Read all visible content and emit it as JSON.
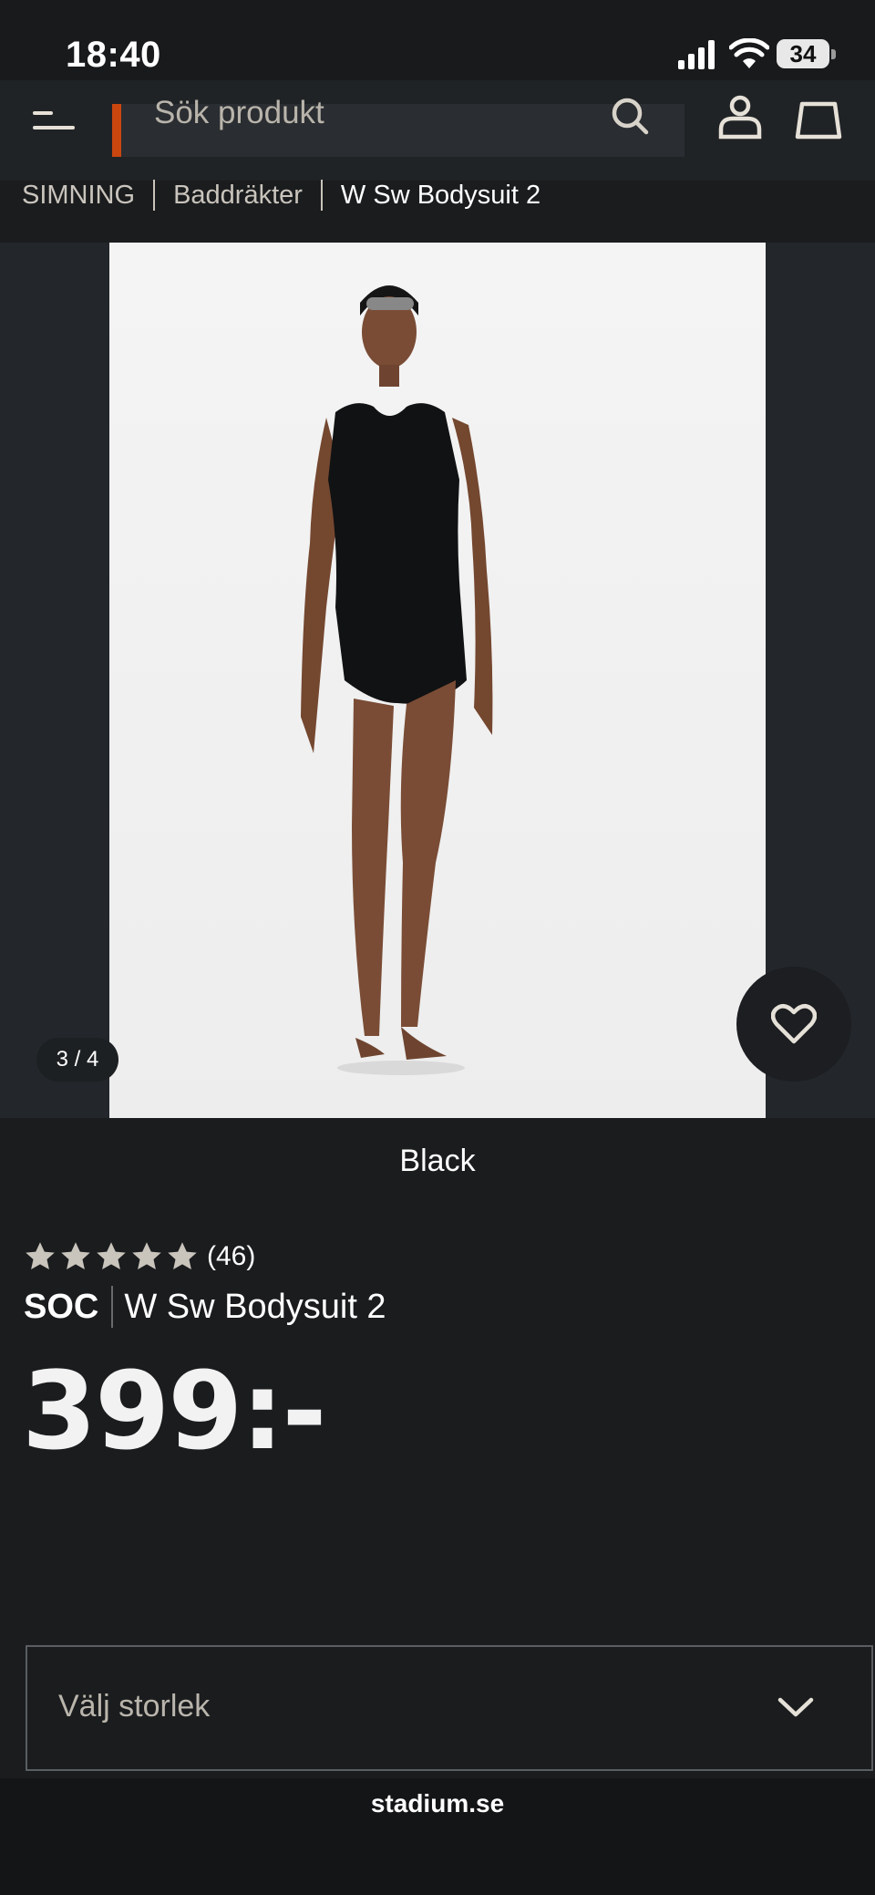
{
  "status_bar": {
    "time": "18:40",
    "battery": "34"
  },
  "header": {
    "search_placeholder": "Sök produkt",
    "accent_color": "#c9470f"
  },
  "breadcrumb": {
    "items": [
      "SIMNING",
      "Baddräkter",
      "W Sw Bodysuit 2"
    ]
  },
  "gallery": {
    "counter": "3 / 4"
  },
  "product": {
    "color": "Black",
    "rating_stars": 5,
    "review_count": "(46)",
    "brand": "SOC",
    "name": "W Sw Bodysuit 2",
    "price": "399:-"
  },
  "size_select": {
    "label": "Välj storlek"
  },
  "browser": {
    "url": "stadium.se"
  },
  "icons": [
    "menu-icon",
    "search-icon",
    "account-icon",
    "cart-icon",
    "heart-icon",
    "star-icon",
    "chevron-down-icon"
  ]
}
